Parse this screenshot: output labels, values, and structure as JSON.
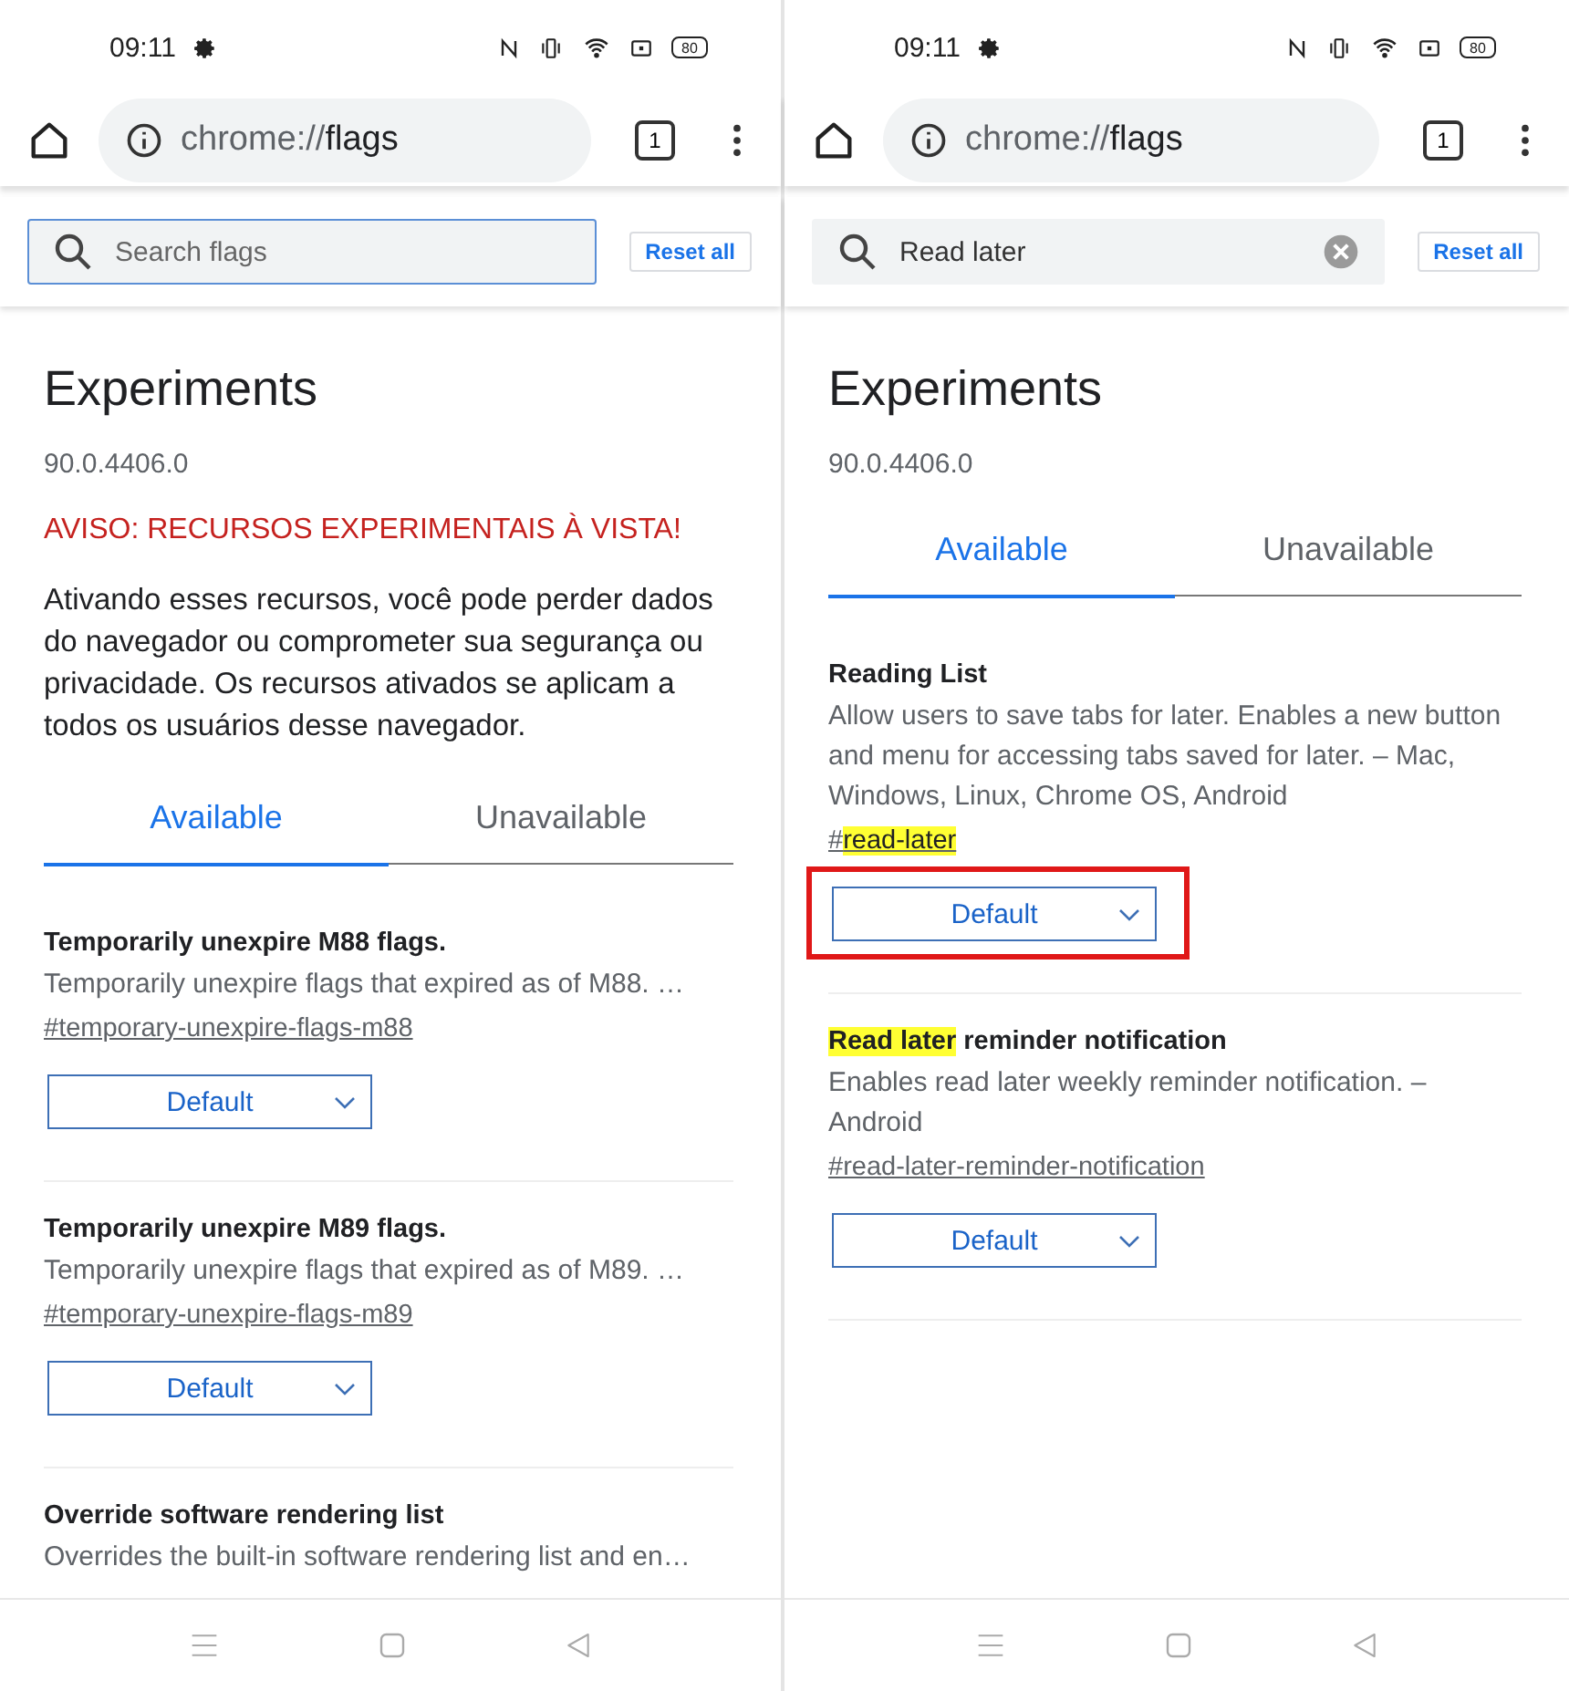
{
  "screens": [
    {
      "status": {
        "time": "09:11",
        "battery": "80"
      },
      "url": {
        "scheme": "chrome://",
        "path": "flags"
      },
      "tab_count": "1",
      "search": {
        "placeholder": "Search flags",
        "focused": true
      },
      "reset_button": "Reset all",
      "heading": "Experiments",
      "version": "90.0.4406.0",
      "warning": "AVISO: RECURSOS EXPERIMENTAIS À VISTA!",
      "description": "Ativando esses recursos, você pode perder dados do navegador ou comprometer sua segurança ou privacidade. Os recursos ativados se aplicam a todos os usuários desse navegador.",
      "tabs": [
        {
          "label": "Available",
          "selected": true
        },
        {
          "label": "Unavailable",
          "selected": false
        }
      ],
      "flags": [
        {
          "title": [
            {
              "text": "Temporarily unexpire M88 flags.",
              "highlighted": false
            }
          ],
          "description": "Temporarily unexpire flags that expired as of M88. …",
          "link": [
            {
              "text": "#temporary-unexpire-flags-m88",
              "highlighted": false
            }
          ],
          "select": "Default",
          "outlined": false
        },
        {
          "title": [
            {
              "text": "Temporarily unexpire M89 flags.",
              "highlighted": false
            }
          ],
          "description": "Temporarily unexpire flags that expired as of M89. …",
          "link": [
            {
              "text": "#temporary-unexpire-flags-m89",
              "highlighted": false
            }
          ],
          "select": "Default",
          "outlined": false
        },
        {
          "title": [
            {
              "text": "Override software rendering list",
              "highlighted": false
            }
          ],
          "description": "Overrides the built-in software rendering list and en…"
        }
      ]
    },
    {
      "status": {
        "time": "09:11",
        "battery": "80"
      },
      "url": {
        "scheme": "chrome://",
        "path": "flags"
      },
      "tab_count": "1",
      "search": {
        "value": "Read later",
        "focused": false
      },
      "reset_button": "Reset all",
      "heading": "Experiments",
      "version": "90.0.4406.0",
      "tabs": [
        {
          "label": "Available",
          "selected": true
        },
        {
          "label": "Unavailable",
          "selected": false
        }
      ],
      "flags": [
        {
          "title": [
            {
              "text": "Reading List",
              "highlighted": false
            }
          ],
          "description": "Allow users to save tabs for later. Enables a new button and menu for accessing tabs saved for later. – Mac, Windows, Linux, Chrome OS, Android",
          "link": [
            {
              "text": "#",
              "highlighted": false
            },
            {
              "text": "read-later",
              "highlighted": true
            }
          ],
          "select": "Default",
          "outlined": true
        },
        {
          "title": [
            {
              "text": "Read later",
              "highlighted": true
            },
            {
              "text": " reminder notification",
              "highlighted": false
            }
          ],
          "description": "Enables read later weekly reminder notification. – Android",
          "link": [
            {
              "text": "#read-later-reminder-notification",
              "highlighted": false
            }
          ],
          "select": "Default",
          "outlined": false
        }
      ]
    }
  ]
}
